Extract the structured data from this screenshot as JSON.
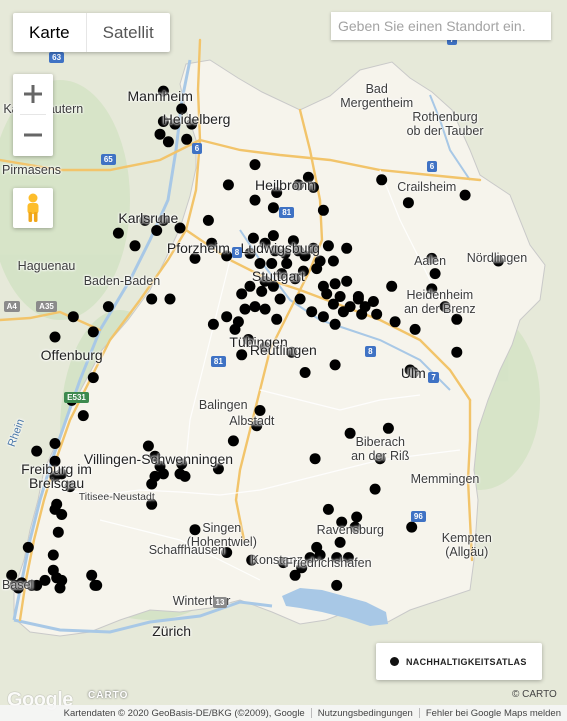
{
  "map_type": {
    "map_label": "Karte",
    "satellite_label": "Satellit",
    "selected": "Karte"
  },
  "search": {
    "placeholder": "Geben Sie einen Standort ein."
  },
  "zoom": {
    "in_icon": "plus-icon",
    "out_icon": "minus-icon"
  },
  "street_view": {
    "icon": "pegman-icon"
  },
  "legend": {
    "label": "NACHHALTIGKEITSATLAS",
    "marker_color": "#111111"
  },
  "colors": {
    "land": "#e8ebdc",
    "region": "#f7f5ee",
    "water": "#a8c8e6",
    "highway": "#f5c66a",
    "road": "#ffffff",
    "marker": "#000000"
  },
  "places": [
    {
      "label": "Mannheim",
      "size": "big",
      "lon": 8.47,
      "lat": 49.49
    },
    {
      "label": "Heidelberg",
      "size": "big",
      "lon": 8.69,
      "lat": 49.4
    },
    {
      "label": "Kaiserslautern",
      "size": "normal",
      "lon": 7.77,
      "lat": 49.44
    },
    {
      "label": "Pirmasens",
      "size": "normal",
      "lon": 7.6,
      "lat": 49.2
    },
    {
      "label": "Bad Mergentheim",
      "size": "normal",
      "lon": 9.77,
      "lat": 49.49
    },
    {
      "label": "Rothenburg ob der Tauber",
      "size": "normal",
      "lon": 10.18,
      "lat": 49.38
    },
    {
      "label": "Heilbronn",
      "size": "big",
      "lon": 9.22,
      "lat": 49.14
    },
    {
      "label": "Crailsheim",
      "size": "normal",
      "lon": 10.07,
      "lat": 49.13
    },
    {
      "label": "Karlsruhe",
      "size": "big",
      "lon": 8.4,
      "lat": 49.01
    },
    {
      "label": "Pforzheim",
      "size": "big",
      "lon": 8.7,
      "lat": 48.89
    },
    {
      "label": "Ludwigsburg",
      "size": "big",
      "lon": 9.19,
      "lat": 48.89
    },
    {
      "label": "Stuttgart",
      "size": "big",
      "lon": 9.18,
      "lat": 48.78
    },
    {
      "label": "Aalen",
      "size": "normal",
      "lon": 10.09,
      "lat": 48.84
    },
    {
      "label": "Nördlingen",
      "size": "normal",
      "lon": 10.49,
      "lat": 48.85
    },
    {
      "label": "Baden-Baden",
      "size": "normal",
      "lon": 8.24,
      "lat": 48.76
    },
    {
      "label": "Heidenheim an der Brenz",
      "size": "normal",
      "lon": 10.15,
      "lat": 48.68
    },
    {
      "label": "Haguenau",
      "size": "normal",
      "lon": 7.79,
      "lat": 48.82
    },
    {
      "label": "Offenburg",
      "size": "big",
      "lon": 7.94,
      "lat": 48.47
    },
    {
      "label": "Tübingen",
      "size": "big",
      "lon": 9.06,
      "lat": 48.52
    },
    {
      "label": "Reutlingen",
      "size": "big",
      "lon": 9.21,
      "lat": 48.49
    },
    {
      "label": "Ulm",
      "size": "big",
      "lon": 9.99,
      "lat": 48.4
    },
    {
      "label": "Balingen",
      "size": "normal",
      "lon": 8.85,
      "lat": 48.27
    },
    {
      "label": "Albstadt",
      "size": "normal",
      "lon": 9.02,
      "lat": 48.21
    },
    {
      "label": "Biberach an der Riß",
      "size": "normal",
      "lon": 9.79,
      "lat": 48.1
    },
    {
      "label": "Freiburg im Breisgau",
      "size": "big",
      "lon": 7.85,
      "lat": 47.99
    },
    {
      "label": "Villingen-Schwenningen",
      "size": "big",
      "lon": 8.46,
      "lat": 48.06
    },
    {
      "label": "Titisee-Neustadt",
      "size": "small",
      "lon": 8.21,
      "lat": 47.91
    },
    {
      "label": "Memmingen",
      "size": "normal",
      "lon": 10.18,
      "lat": 47.98
    },
    {
      "label": "Singen (Hohentwiel)",
      "size": "normal",
      "lon": 8.84,
      "lat": 47.76
    },
    {
      "label": "Ravensburg",
      "size": "normal",
      "lon": 9.61,
      "lat": 47.78
    },
    {
      "label": "Kempten (Allgäu)",
      "size": "normal",
      "lon": 10.31,
      "lat": 47.72
    },
    {
      "label": "Schaffhausen",
      "size": "normal",
      "lon": 8.63,
      "lat": 47.7
    },
    {
      "label": "Konstanz",
      "size": "normal",
      "lon": 9.17,
      "lat": 47.66
    },
    {
      "label": "Friedrichshafen",
      "size": "normal",
      "lon": 9.48,
      "lat": 47.65
    },
    {
      "label": "Basel",
      "size": "normal",
      "lon": 7.59,
      "lat": 47.56
    },
    {
      "label": "Winterthur",
      "size": "normal",
      "lon": 8.72,
      "lat": 47.5
    },
    {
      "label": "Zürich",
      "size": "big",
      "lon": 8.54,
      "lat": 47.38
    },
    {
      "label": "Rhein",
      "size": "water",
      "lon": 7.6,
      "lat": 48.16
    }
  ],
  "road_shields": [
    {
      "label": "67",
      "kind": "blue",
      "lon": 8.36,
      "lat": 49.78
    },
    {
      "label": "63",
      "kind": "blue",
      "lon": 7.85,
      "lat": 49.64
    },
    {
      "label": "6",
      "kind": "blue",
      "lon": 8.69,
      "lat": 49.28
    },
    {
      "label": "65",
      "kind": "blue",
      "lon": 8.16,
      "lat": 49.24
    },
    {
      "label": "7",
      "kind": "blue",
      "lon": 10.22,
      "lat": 49.71
    },
    {
      "label": "6",
      "kind": "blue",
      "lon": 10.1,
      "lat": 49.21
    },
    {
      "label": "81",
      "kind": "blue",
      "lon": 9.23,
      "lat": 49.03
    },
    {
      "label": "8",
      "kind": "blue",
      "lon": 8.93,
      "lat": 48.87
    },
    {
      "label": "81",
      "kind": "blue",
      "lon": 8.82,
      "lat": 48.44
    },
    {
      "label": "8",
      "kind": "blue",
      "lon": 9.73,
      "lat": 48.48
    },
    {
      "label": "7",
      "kind": "blue",
      "lon": 10.11,
      "lat": 48.38
    },
    {
      "label": "A4",
      "kind": "gray",
      "lon": 7.58,
      "lat": 48.66
    },
    {
      "label": "A35",
      "kind": "gray",
      "lon": 7.79,
      "lat": 48.66
    },
    {
      "label": "E531",
      "kind": "green",
      "lon": 7.97,
      "lat": 48.3
    },
    {
      "label": "96",
      "kind": "blue",
      "lon": 10.02,
      "lat": 47.83
    },
    {
      "label": "13",
      "kind": "gray",
      "lon": 8.83,
      "lat": 47.49
    }
  ],
  "markers": [
    {
      "lon": 8.49,
      "lat": 49.51
    },
    {
      "lon": 8.6,
      "lat": 49.44
    },
    {
      "lon": 8.49,
      "lat": 49.39
    },
    {
      "lon": 8.56,
      "lat": 49.38
    },
    {
      "lon": 8.66,
      "lat": 49.38
    },
    {
      "lon": 8.47,
      "lat": 49.34
    },
    {
      "lon": 8.63,
      "lat": 49.32
    },
    {
      "lon": 8.52,
      "lat": 49.31
    },
    {
      "lon": 9.04,
      "lat": 49.22
    },
    {
      "lon": 8.88,
      "lat": 49.14
    },
    {
      "lon": 9.3,
      "lat": 49.14
    },
    {
      "lon": 9.04,
      "lat": 49.08
    },
    {
      "lon": 9.17,
      "lat": 49.11
    },
    {
      "lon": 9.39,
      "lat": 49.13
    },
    {
      "lon": 9.36,
      "lat": 49.17
    },
    {
      "lon": 9.8,
      "lat": 49.16
    },
    {
      "lon": 9.96,
      "lat": 49.07
    },
    {
      "lon": 10.3,
      "lat": 49.1
    },
    {
      "lon": 9.15,
      "lat": 49.05
    },
    {
      "lon": 9.45,
      "lat": 49.04
    },
    {
      "lon": 8.38,
      "lat": 49.0
    },
    {
      "lon": 8.49,
      "lat": 49.0
    },
    {
      "lon": 8.76,
      "lat": 49.0
    },
    {
      "lon": 8.45,
      "lat": 48.96
    },
    {
      "lon": 8.59,
      "lat": 48.97
    },
    {
      "lon": 8.22,
      "lat": 48.95
    },
    {
      "lon": 8.32,
      "lat": 48.9
    },
    {
      "lon": 8.78,
      "lat": 48.91
    },
    {
      "lon": 9.03,
      "lat": 48.93
    },
    {
      "lon": 9.15,
      "lat": 48.94
    },
    {
      "lon": 9.27,
      "lat": 48.92
    },
    {
      "lon": 9.39,
      "lat": 48.89
    },
    {
      "lon": 9.48,
      "lat": 48.9
    },
    {
      "lon": 9.1,
      "lat": 48.91
    },
    {
      "lon": 9.3,
      "lat": 48.88
    },
    {
      "lon": 9.16,
      "lat": 48.88
    },
    {
      "lon": 9.22,
      "lat": 48.87
    },
    {
      "lon": 9.34,
      "lat": 48.86
    },
    {
      "lon": 9.43,
      "lat": 48.84
    },
    {
      "lon": 9.51,
      "lat": 48.84
    },
    {
      "lon": 9.59,
      "lat": 48.89
    },
    {
      "lon": 8.68,
      "lat": 48.85
    },
    {
      "lon": 8.87,
      "lat": 48.86
    },
    {
      "lon": 9.01,
      "lat": 48.87
    },
    {
      "lon": 9.07,
      "lat": 48.83
    },
    {
      "lon": 9.14,
      "lat": 48.83
    },
    {
      "lon": 9.23,
      "lat": 48.83
    },
    {
      "lon": 9.33,
      "lat": 48.8
    },
    {
      "lon": 9.41,
      "lat": 48.81
    },
    {
      "lon": 10.1,
      "lat": 48.85
    },
    {
      "lon": 10.5,
      "lat": 48.84
    },
    {
      "lon": 10.12,
      "lat": 48.79
    },
    {
      "lon": 10.1,
      "lat": 48.73
    },
    {
      "lon": 9.86,
      "lat": 48.74
    },
    {
      "lon": 9.28,
      "lat": 48.77
    },
    {
      "lon": 9.2,
      "lat": 48.79
    },
    {
      "lon": 9.1,
      "lat": 48.76
    },
    {
      "lon": 9.01,
      "lat": 48.74
    },
    {
      "lon": 8.96,
      "lat": 48.71
    },
    {
      "lon": 9.08,
      "lat": 48.72
    },
    {
      "lon": 9.15,
      "lat": 48.74
    },
    {
      "lon": 9.45,
      "lat": 48.74
    },
    {
      "lon": 9.52,
      "lat": 48.75
    },
    {
      "lon": 9.59,
      "lat": 48.76
    },
    {
      "lon": 9.47,
      "lat": 48.71
    },
    {
      "lon": 9.55,
      "lat": 48.7
    },
    {
      "lon": 9.66,
      "lat": 48.69
    },
    {
      "lon": 9.51,
      "lat": 48.67
    },
    {
      "lon": 9.61,
      "lat": 48.66
    },
    {
      "lon": 9.7,
      "lat": 48.66
    },
    {
      "lon": 9.75,
      "lat": 48.68
    },
    {
      "lon": 9.66,
      "lat": 48.7
    },
    {
      "lon": 9.57,
      "lat": 48.64
    },
    {
      "lon": 9.31,
      "lat": 48.69
    },
    {
      "lon": 9.19,
      "lat": 48.69
    },
    {
      "lon": 9.04,
      "lat": 48.66
    },
    {
      "lon": 8.98,
      "lat": 48.65
    },
    {
      "lon": 9.1,
      "lat": 48.65
    },
    {
      "lon": 9.17,
      "lat": 48.61
    },
    {
      "lon": 9.38,
      "lat": 48.64
    },
    {
      "lon": 9.45,
      "lat": 48.62
    },
    {
      "lon": 9.52,
      "lat": 48.59
    },
    {
      "lon": 9.68,
      "lat": 48.63
    },
    {
      "lon": 9.77,
      "lat": 48.63
    },
    {
      "lon": 9.88,
      "lat": 48.6
    },
    {
      "lon": 10.0,
      "lat": 48.57
    },
    {
      "lon": 10.18,
      "lat": 48.66
    },
    {
      "lon": 10.25,
      "lat": 48.61
    },
    {
      "lon": 8.87,
      "lat": 48.62
    },
    {
      "lon": 8.94,
      "lat": 48.6
    },
    {
      "lon": 8.79,
      "lat": 48.59
    },
    {
      "lon": 8.92,
      "lat": 48.57
    },
    {
      "lon": 9.0,
      "lat": 48.53
    },
    {
      "lon": 8.96,
      "lat": 48.47
    },
    {
      "lon": 9.1,
      "lat": 48.5
    },
    {
      "lon": 9.26,
      "lat": 48.48
    },
    {
      "lon": 9.34,
      "lat": 48.4
    },
    {
      "lon": 9.52,
      "lat": 48.43
    },
    {
      "lon": 9.97,
      "lat": 48.41
    },
    {
      "lon": 9.99,
      "lat": 48.4
    },
    {
      "lon": 10.25,
      "lat": 48.48
    },
    {
      "lon": 8.42,
      "lat": 48.69
    },
    {
      "lon": 8.53,
      "lat": 48.69
    },
    {
      "lon": 7.95,
      "lat": 48.62
    },
    {
      "lon": 8.16,
      "lat": 48.66
    },
    {
      "lon": 8.07,
      "lat": 48.56
    },
    {
      "lon": 7.84,
      "lat": 48.54
    },
    {
      "lon": 8.07,
      "lat": 48.38
    },
    {
      "lon": 7.94,
      "lat": 48.29
    },
    {
      "lon": 8.01,
      "lat": 48.23
    },
    {
      "lon": 7.73,
      "lat": 48.09
    },
    {
      "lon": 7.84,
      "lat": 48.12
    },
    {
      "lon": 7.84,
      "lat": 48.05
    },
    {
      "lon": 7.84,
      "lat": 47.99
    },
    {
      "lon": 7.88,
      "lat": 48.0
    },
    {
      "lon": 7.93,
      "lat": 47.95
    },
    {
      "lon": 7.85,
      "lat": 47.88
    },
    {
      "lon": 7.88,
      "lat": 47.84
    },
    {
      "lon": 7.84,
      "lat": 47.86
    },
    {
      "lon": 8.4,
      "lat": 48.11
    },
    {
      "lon": 8.44,
      "lat": 48.07
    },
    {
      "lon": 8.44,
      "lat": 47.99
    },
    {
      "lon": 8.59,
      "lat": 48.0
    },
    {
      "lon": 8.47,
      "lat": 48.03
    },
    {
      "lon": 8.62,
      "lat": 47.99
    },
    {
      "lon": 8.6,
      "lat": 48.04
    },
    {
      "lon": 8.49,
      "lat": 48.0
    },
    {
      "lon": 8.42,
      "lat": 47.96
    },
    {
      "lon": 8.42,
      "lat": 47.88
    },
    {
      "lon": 7.86,
      "lat": 47.77
    },
    {
      "lon": 7.68,
      "lat": 47.71
    },
    {
      "lon": 7.83,
      "lat": 47.68
    },
    {
      "lon": 7.83,
      "lat": 47.62
    },
    {
      "lon": 7.85,
      "lat": 47.59
    },
    {
      "lon": 7.88,
      "lat": 47.58
    },
    {
      "lon": 8.06,
      "lat": 47.6
    },
    {
      "lon": 8.08,
      "lat": 47.56
    },
    {
      "lon": 7.58,
      "lat": 47.6
    },
    {
      "lon": 7.6,
      "lat": 47.56
    },
    {
      "lon": 7.62,
      "lat": 47.55
    },
    {
      "lon": 7.64,
      "lat": 47.57
    },
    {
      "lon": 7.7,
      "lat": 47.56
    },
    {
      "lon": 7.73,
      "lat": 47.56
    },
    {
      "lon": 7.78,
      "lat": 47.58
    },
    {
      "lon": 7.87,
      "lat": 47.55
    },
    {
      "lon": 8.09,
      "lat": 47.56
    },
    {
      "lon": 8.87,
      "lat": 47.69
    },
    {
      "lon": 9.02,
      "lat": 47.66
    },
    {
      "lon": 9.21,
      "lat": 47.65
    },
    {
      "lon": 9.37,
      "lat": 47.67
    },
    {
      "lon": 9.41,
      "lat": 47.71
    },
    {
      "lon": 9.43,
      "lat": 47.68
    },
    {
      "lon": 9.53,
      "lat": 47.67
    },
    {
      "lon": 9.55,
      "lat": 47.73
    },
    {
      "lon": 9.56,
      "lat": 47.81
    },
    {
      "lon": 9.65,
      "lat": 47.83
    },
    {
      "lon": 9.64,
      "lat": 47.79
    },
    {
      "lon": 9.53,
      "lat": 47.56
    },
    {
      "lon": 9.6,
      "lat": 47.67
    },
    {
      "lon": 9.48,
      "lat": 47.86
    },
    {
      "lon": 9.76,
      "lat": 47.94
    },
    {
      "lon": 9.98,
      "lat": 47.79
    },
    {
      "lon": 9.84,
      "lat": 48.18
    },
    {
      "lon": 9.61,
      "lat": 48.16
    },
    {
      "lon": 9.79,
      "lat": 48.06
    },
    {
      "lon": 9.4,
      "lat": 48.06
    },
    {
      "lon": 9.07,
      "lat": 48.25
    },
    {
      "lon": 9.05,
      "lat": 48.19
    },
    {
      "lon": 8.91,
      "lat": 48.13
    },
    {
      "lon": 8.82,
      "lat": 48.02
    },
    {
      "lon": 9.32,
      "lat": 47.63
    },
    {
      "lon": 9.28,
      "lat": 47.6
    },
    {
      "lon": 8.68,
      "lat": 47.78
    }
  ]
}
